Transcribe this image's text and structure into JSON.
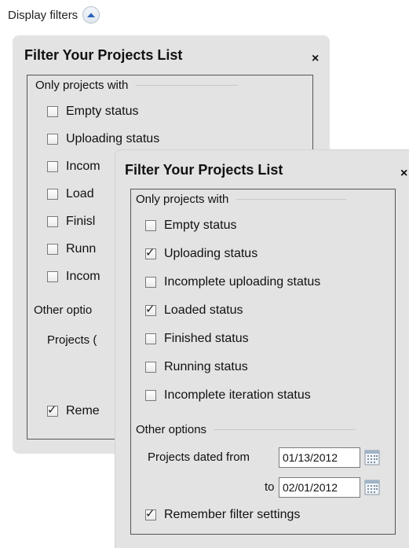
{
  "display_filters": {
    "label": "Display filters"
  },
  "back_panel": {
    "title": "Filter Your Projects List",
    "close": "×",
    "section_label": "Only projects with",
    "items": [
      {
        "label": "Empty status",
        "checked": false
      },
      {
        "label": "Uploading status",
        "checked": false
      },
      {
        "label": "Incom",
        "checked": false
      },
      {
        "label": "Load",
        "checked": false
      },
      {
        "label": "Finisl",
        "checked": false
      },
      {
        "label": "Runn",
        "checked": false
      },
      {
        "label": "Incom",
        "checked": false
      }
    ],
    "other_label": "Other optio",
    "projects_label": "Projects (",
    "remember_label": "Reme",
    "remember_checked": true
  },
  "front_panel": {
    "title": "Filter Your Projects List",
    "close": "×",
    "section_label": "Only projects with",
    "items": [
      {
        "label": "Empty status",
        "checked": false
      },
      {
        "label": "Uploading status",
        "checked": true
      },
      {
        "label": "Incomplete uploading status",
        "checked": false
      },
      {
        "label": "Loaded status",
        "checked": true
      },
      {
        "label": "Finished status",
        "checked": false
      },
      {
        "label": "Running status",
        "checked": false
      },
      {
        "label": "Incomplete iteration status",
        "checked": false
      }
    ],
    "other_label": "Other options",
    "dated_from_label": "Projects dated from",
    "date_from": "01/13/2012",
    "to_label": "to",
    "date_to": "02/01/2012",
    "remember_label": "Remember filter settings",
    "remember_checked": true
  },
  "check_glyph": "✓",
  "colors": {
    "panel_bg": "#e3e3e3",
    "border": "#555555",
    "text": "#111111"
  },
  "icons": {
    "toggle": "chevron-up-icon",
    "close": "close-icon",
    "calendar": "calendar-icon",
    "check": "check-icon"
  }
}
